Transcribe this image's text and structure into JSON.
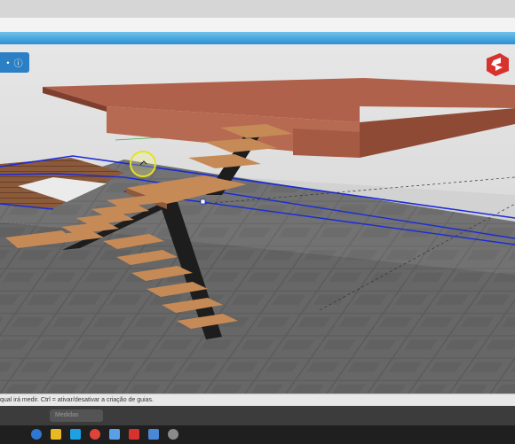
{
  "viewport_button": {
    "icon_name": "info-icon",
    "glyph": "ⓘ",
    "prefix": "•"
  },
  "statusbar": {
    "text": "qual irá medir. Ctrl = ativar/desativar a criação de guias."
  },
  "dark_pill": {
    "label": "Medidas"
  },
  "taskbar": {
    "icons": [
      {
        "name": "windows-start-icon",
        "color": "#2f77d1"
      },
      {
        "name": "file-explorer-icon",
        "color": "#e8b923"
      },
      {
        "name": "edge-icon",
        "color": "#1da1e2"
      },
      {
        "name": "chrome-icon",
        "color": "#de4437"
      },
      {
        "name": "photos-icon",
        "color": "#5aa0e6"
      },
      {
        "name": "sketchup-icon",
        "color": "#d7322d"
      },
      {
        "name": "store-icon",
        "color": "#4b87d6"
      },
      {
        "name": "settings-icon",
        "color": "#8a8a8a"
      }
    ]
  },
  "colors": {
    "sky": "#dcdcdc",
    "floor_tile": "#5a5a5a",
    "slab_top": "#b0614b",
    "stair_tread": "#c68a57",
    "stringer": "#1d1d1d",
    "selection_blue": "#1a2bd8",
    "brand_red": "#d7322d"
  }
}
